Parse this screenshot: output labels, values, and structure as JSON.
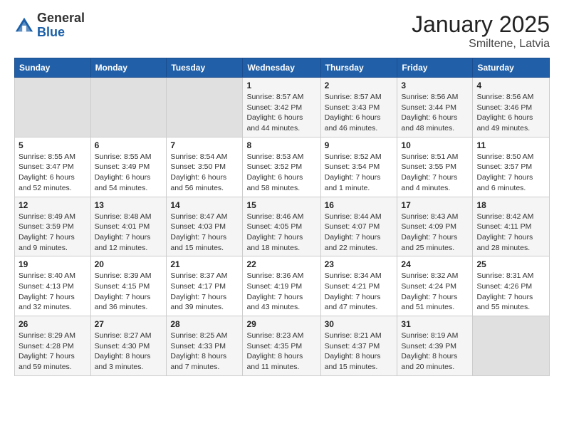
{
  "logo": {
    "general": "General",
    "blue": "Blue"
  },
  "header": {
    "month": "January 2025",
    "location": "Smiltene, Latvia"
  },
  "weekdays": [
    "Sunday",
    "Monday",
    "Tuesday",
    "Wednesday",
    "Thursday",
    "Friday",
    "Saturday"
  ],
  "weeks": [
    [
      {
        "day": "",
        "info": ""
      },
      {
        "day": "",
        "info": ""
      },
      {
        "day": "",
        "info": ""
      },
      {
        "day": "1",
        "info": "Sunrise: 8:57 AM\nSunset: 3:42 PM\nDaylight: 6 hours\nand 44 minutes."
      },
      {
        "day": "2",
        "info": "Sunrise: 8:57 AM\nSunset: 3:43 PM\nDaylight: 6 hours\nand 46 minutes."
      },
      {
        "day": "3",
        "info": "Sunrise: 8:56 AM\nSunset: 3:44 PM\nDaylight: 6 hours\nand 48 minutes."
      },
      {
        "day": "4",
        "info": "Sunrise: 8:56 AM\nSunset: 3:46 PM\nDaylight: 6 hours\nand 49 minutes."
      }
    ],
    [
      {
        "day": "5",
        "info": "Sunrise: 8:55 AM\nSunset: 3:47 PM\nDaylight: 6 hours\nand 52 minutes."
      },
      {
        "day": "6",
        "info": "Sunrise: 8:55 AM\nSunset: 3:49 PM\nDaylight: 6 hours\nand 54 minutes."
      },
      {
        "day": "7",
        "info": "Sunrise: 8:54 AM\nSunset: 3:50 PM\nDaylight: 6 hours\nand 56 minutes."
      },
      {
        "day": "8",
        "info": "Sunrise: 8:53 AM\nSunset: 3:52 PM\nDaylight: 6 hours\nand 58 minutes."
      },
      {
        "day": "9",
        "info": "Sunrise: 8:52 AM\nSunset: 3:54 PM\nDaylight: 7 hours\nand 1 minute."
      },
      {
        "day": "10",
        "info": "Sunrise: 8:51 AM\nSunset: 3:55 PM\nDaylight: 7 hours\nand 4 minutes."
      },
      {
        "day": "11",
        "info": "Sunrise: 8:50 AM\nSunset: 3:57 PM\nDaylight: 7 hours\nand 6 minutes."
      }
    ],
    [
      {
        "day": "12",
        "info": "Sunrise: 8:49 AM\nSunset: 3:59 PM\nDaylight: 7 hours\nand 9 minutes."
      },
      {
        "day": "13",
        "info": "Sunrise: 8:48 AM\nSunset: 4:01 PM\nDaylight: 7 hours\nand 12 minutes."
      },
      {
        "day": "14",
        "info": "Sunrise: 8:47 AM\nSunset: 4:03 PM\nDaylight: 7 hours\nand 15 minutes."
      },
      {
        "day": "15",
        "info": "Sunrise: 8:46 AM\nSunset: 4:05 PM\nDaylight: 7 hours\nand 18 minutes."
      },
      {
        "day": "16",
        "info": "Sunrise: 8:44 AM\nSunset: 4:07 PM\nDaylight: 7 hours\nand 22 minutes."
      },
      {
        "day": "17",
        "info": "Sunrise: 8:43 AM\nSunset: 4:09 PM\nDaylight: 7 hours\nand 25 minutes."
      },
      {
        "day": "18",
        "info": "Sunrise: 8:42 AM\nSunset: 4:11 PM\nDaylight: 7 hours\nand 28 minutes."
      }
    ],
    [
      {
        "day": "19",
        "info": "Sunrise: 8:40 AM\nSunset: 4:13 PM\nDaylight: 7 hours\nand 32 minutes."
      },
      {
        "day": "20",
        "info": "Sunrise: 8:39 AM\nSunset: 4:15 PM\nDaylight: 7 hours\nand 36 minutes."
      },
      {
        "day": "21",
        "info": "Sunrise: 8:37 AM\nSunset: 4:17 PM\nDaylight: 7 hours\nand 39 minutes."
      },
      {
        "day": "22",
        "info": "Sunrise: 8:36 AM\nSunset: 4:19 PM\nDaylight: 7 hours\nand 43 minutes."
      },
      {
        "day": "23",
        "info": "Sunrise: 8:34 AM\nSunset: 4:21 PM\nDaylight: 7 hours\nand 47 minutes."
      },
      {
        "day": "24",
        "info": "Sunrise: 8:32 AM\nSunset: 4:24 PM\nDaylight: 7 hours\nand 51 minutes."
      },
      {
        "day": "25",
        "info": "Sunrise: 8:31 AM\nSunset: 4:26 PM\nDaylight: 7 hours\nand 55 minutes."
      }
    ],
    [
      {
        "day": "26",
        "info": "Sunrise: 8:29 AM\nSunset: 4:28 PM\nDaylight: 7 hours\nand 59 minutes."
      },
      {
        "day": "27",
        "info": "Sunrise: 8:27 AM\nSunset: 4:30 PM\nDaylight: 8 hours\nand 3 minutes."
      },
      {
        "day": "28",
        "info": "Sunrise: 8:25 AM\nSunset: 4:33 PM\nDaylight: 8 hours\nand 7 minutes."
      },
      {
        "day": "29",
        "info": "Sunrise: 8:23 AM\nSunset: 4:35 PM\nDaylight: 8 hours\nand 11 minutes."
      },
      {
        "day": "30",
        "info": "Sunrise: 8:21 AM\nSunset: 4:37 PM\nDaylight: 8 hours\nand 15 minutes."
      },
      {
        "day": "31",
        "info": "Sunrise: 8:19 AM\nSunset: 4:39 PM\nDaylight: 8 hours\nand 20 minutes."
      },
      {
        "day": "",
        "info": ""
      }
    ]
  ]
}
